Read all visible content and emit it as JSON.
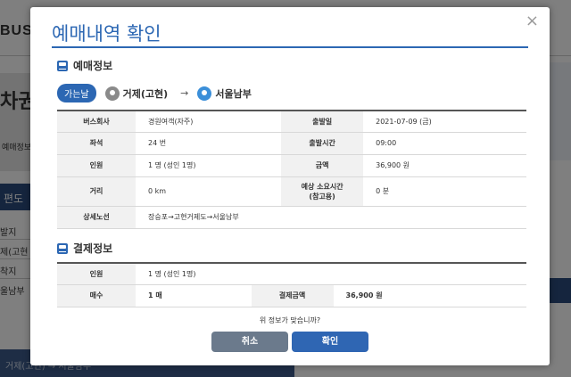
{
  "background": {
    "logo": "BUST",
    "page_title": "차권",
    "sub_label": "예매정보",
    "panel_label": "편도",
    "side_items": [
      "발지",
      "제(고현",
      "착지",
      "울남부"
    ],
    "footer_text": "거제(고현) → 서울남부"
  },
  "modal": {
    "title": "예매내역 확인",
    "close_label": "×",
    "reservation_section": "예매정보",
    "direction_badge": "가는날",
    "origin": "거제(고현)",
    "arrow": "→",
    "destination": "서울남부",
    "reservation_rows": [
      {
        "l1": "버스회사",
        "v1": "경원여객(자주)",
        "l2": "출발일",
        "v2": "2021-07-09 (금)"
      },
      {
        "l1": "좌석",
        "v1": "24 번",
        "l2": "출발시간",
        "v2": "09:00"
      },
      {
        "l1": "인원",
        "v1": "1 명 (성인 1명)",
        "l2": "금액",
        "v2": "36,900 원"
      },
      {
        "l1": "거리",
        "v1": "0 km",
        "l2": "예상 소요시간\n(참고용)",
        "v2": "0 분"
      }
    ],
    "route_label": "상세노선",
    "route_value": "장승포→고현거제도→서울남부",
    "payment_section": "결제정보",
    "payment_people_label": "인원",
    "payment_people_value": "1 명 (성인 1명)",
    "count_label": "매수",
    "count_value": "1 매",
    "total_label": "결제금액",
    "total_value": "36,900 원",
    "question": "위 정보가 맞습니까?",
    "cancel_label": "취소",
    "confirm_label": "확인"
  }
}
